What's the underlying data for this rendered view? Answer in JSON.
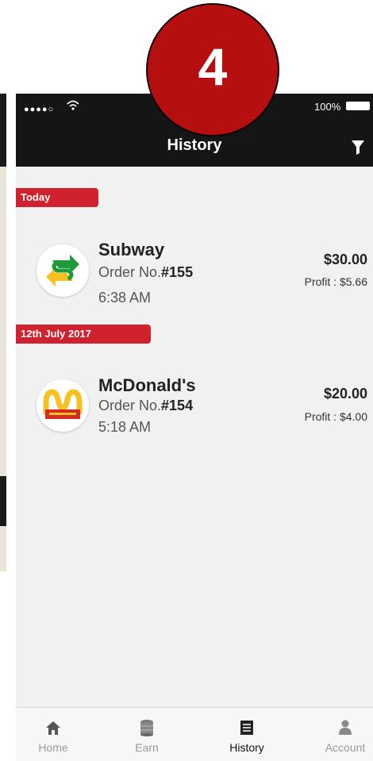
{
  "badge": {
    "step": "4"
  },
  "status_bar": {
    "signal": "●●●●○",
    "battery": "100%"
  },
  "header": {
    "title": "History"
  },
  "sections": [
    {
      "label": "Today",
      "orders": [
        {
          "restaurant": "Subway",
          "order_prefix": "Order No.",
          "order_number": "#155",
          "time": "6:38 AM",
          "amount": "$30.00",
          "profit": "Profit : $5.66",
          "logo": "subway-logo"
        }
      ]
    },
    {
      "label": "12th July 2017",
      "orders": [
        {
          "restaurant": "McDonald's",
          "order_prefix": "Order No.",
          "order_number": "#154",
          "time": "5:18 AM",
          "amount": "$20.00",
          "profit": "Profit : $4.00",
          "logo": "mcdonalds-logo"
        }
      ]
    }
  ],
  "tabbar": {
    "items": [
      {
        "label": "Home",
        "icon": "home-icon"
      },
      {
        "label": "Earn",
        "icon": "coins-icon"
      },
      {
        "label": "History",
        "icon": "list-icon",
        "active": true
      },
      {
        "label": "Account",
        "icon": "user-icon"
      }
    ]
  },
  "colors": {
    "accent": "#d0222e",
    "header_bg": "#151515",
    "badge": "#b5100f"
  }
}
